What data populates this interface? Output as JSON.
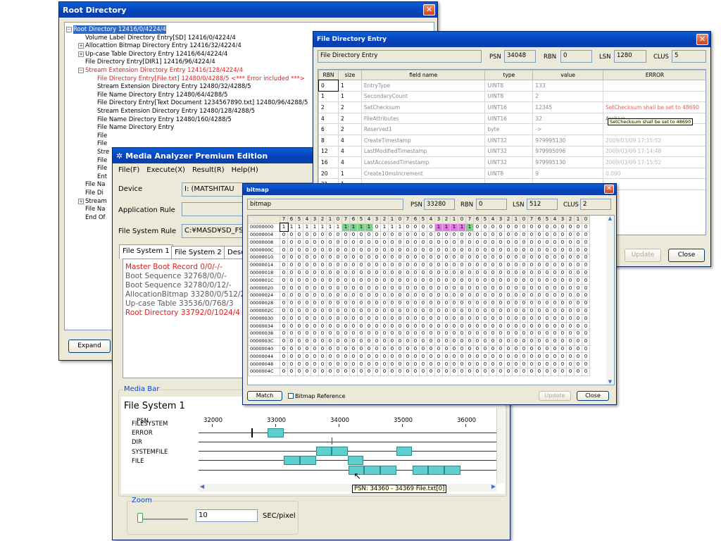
{
  "root_window": {
    "title": "Root Directory",
    "expand_label": "Expand",
    "tree": [
      "Root Directory 12416/0/4224/4",
      "Volume Label Directory Entry[SD] 12416/0/4224/4",
      "Allocattion Bitmap Directory Entry 12416/32/4224/4",
      "Up-case Table Directory Entry 12416/64/4224/4",
      "File Directory Entry[DIR1] 12416/96/4224/4",
      "Stream Extension Directory Entry 12416/128/4224/4",
      "File Directory Entry[File.txt] 12480/0/4288/5 <*** Error included ***>",
      "Stream Extension Directory Entry 12480/32/4288/5",
      "File Name Directory Entry 12480/64/4288/5",
      "File Directory Entry[Text Document 1234567890.txt] 12480/96/4288/5",
      "Stream Extension Directory Entry 12480/128/4288/5",
      "File Name Directory Entry 12480/160/4288/5",
      "File Name Directory Entry",
      "File",
      "File",
      "Stre",
      "File",
      "File",
      "Ent",
      "File Na",
      "File Di",
      "Stream",
      "File Na",
      "End Of"
    ]
  },
  "fde_window": {
    "title": "File Directory Entry",
    "header": {
      "name": "File Directory Entry",
      "psn_label": "PSN",
      "psn": "34048",
      "rbn_label": "RBN",
      "rbn": "0",
      "lsn_label": "LSN",
      "lsn": "1280",
      "clus_label": "CLUS",
      "clus": "5"
    },
    "columns": [
      "RBN",
      "size",
      "field name",
      "type",
      "value",
      "ERROR"
    ],
    "rows": [
      [
        "0",
        "1",
        "EntryType",
        "UINT8",
        "133",
        ""
      ],
      [
        "1",
        "1",
        "SecondaryCount",
        "UINT8",
        "2",
        ""
      ],
      [
        "2",
        "2",
        "SetChecksum",
        "UINT16",
        "12345",
        "SetChecksum shall be set to 48690"
      ],
      [
        "4",
        "2",
        "FileAttributes",
        "UINT16",
        "32",
        "Archive"
      ],
      [
        "6",
        "2",
        "Reserved1",
        "byte",
        "->",
        ""
      ],
      [
        "8",
        "4",
        "CreateTimestamp",
        "UINT32",
        "979995130",
        "2009/03/09 17:15:52"
      ],
      [
        "12",
        "4",
        "LastModifiedTimestamp",
        "UINT32",
        "979995096",
        "2009/03/09 17:14:48"
      ],
      [
        "16",
        "4",
        "LastAccessedTimestamp",
        "UINT32",
        "979995130",
        "2009/03/09 17:15:52"
      ],
      [
        "20",
        "1",
        "Create10msIncrement",
        "UINT8",
        "9",
        "0.090"
      ],
      [
        "21",
        "1",
        "",
        "",
        "",
        ""
      ]
    ],
    "tooltip": "SetChecksum shall be set to 48690",
    "update": "Update",
    "close": "Close"
  },
  "main_window": {
    "title": "Media Analyzer Premium Edition",
    "menu": [
      "File(F)",
      "Execute(X)",
      "Result(R)",
      "Help(H)"
    ],
    "device_label": "Device",
    "device": "I:  (MATSHITAU",
    "app_rule_label": "Application Rule",
    "app_rule": "",
    "fs_rule_label": "File System Rule",
    "fs_rule": "C:¥MASD¥SD_FS_",
    "tabs": [
      "File System 1",
      "File System 2",
      "Desc"
    ],
    "list": [
      {
        "t": "Master Boot Record 0/0/-/-",
        "err": true
      },
      {
        "t": "Boot Sequence 32768/0/0/-",
        "err": false
      },
      {
        "t": "Boot Sequence 32780/0/12/-",
        "err": false
      },
      {
        "t": "AllocationBitmap 33280/0/512/2",
        "err": false
      },
      {
        "t": "Up-case Table 33536/0/768/3",
        "err": false
      },
      {
        "t": "Root Directory 33792/0/1024/4",
        "err": true
      }
    ],
    "media_bar": {
      "label": "Media Bar",
      "heading": "File System 1",
      "rows": [
        "PSN",
        "FILESYSTEM",
        "ERROR",
        "DIR",
        "SYSTEMFILE",
        "FILE"
      ],
      "ticks": [
        "32000",
        "33000",
        "34000",
        "35000",
        "36000"
      ],
      "tooltip": "PSN: 34360 - 34369  File.txt[0]"
    },
    "zoom_label": "Zoom",
    "zoom_value": "10",
    "zoom_unit": "SEC/pixel"
  },
  "bitmap_window": {
    "title": "bitmap",
    "header": {
      "name": "bitmap",
      "psn_label": "PSN",
      "psn": "33280",
      "rbn_label": "RBN",
      "rbn": "0",
      "lsn_label": "LSN",
      "lsn": "512",
      "clus_label": "CLUS",
      "clus": "2"
    },
    "bit_headers": [
      "7",
      "6",
      "5",
      "4",
      "3",
      "2",
      "1",
      "0",
      "7",
      "6",
      "5",
      "4",
      "3",
      "2",
      "1",
      "0",
      "7",
      "6",
      "5",
      "4",
      "3",
      "2",
      "1",
      "0",
      "7",
      "6",
      "5",
      "4",
      "3",
      "2",
      "1",
      "0",
      "7",
      "6",
      "5",
      "4",
      "3",
      "2",
      "1",
      "0"
    ],
    "addresses": [
      "00000000",
      "00000004",
      "00000008",
      "0000000C",
      "00000010",
      "00000014",
      "00000018",
      "0000001C",
      "00000020",
      "00000024",
      "00000028",
      "0000002C",
      "00000030",
      "00000034",
      "00000038",
      "0000003C",
      "00000040",
      "00000044",
      "00000048",
      "0000004C"
    ],
    "first_row": [
      "1",
      "1",
      "1",
      "1",
      "1",
      "1",
      "1",
      "1",
      "1",
      "1",
      "1",
      "1",
      "0",
      "1",
      "1",
      "1",
      "0",
      "0",
      "0",
      "0",
      "1",
      "1",
      "1",
      "1",
      "1",
      "0",
      "0",
      "0",
      "0",
      "0",
      "0",
      "0",
      "0",
      "0",
      "0",
      "0",
      "0",
      "0",
      "0",
      "0"
    ],
    "match": "Match",
    "bitmap_ref": "Bitmap Reference",
    "update": "Update",
    "close": "Close"
  }
}
